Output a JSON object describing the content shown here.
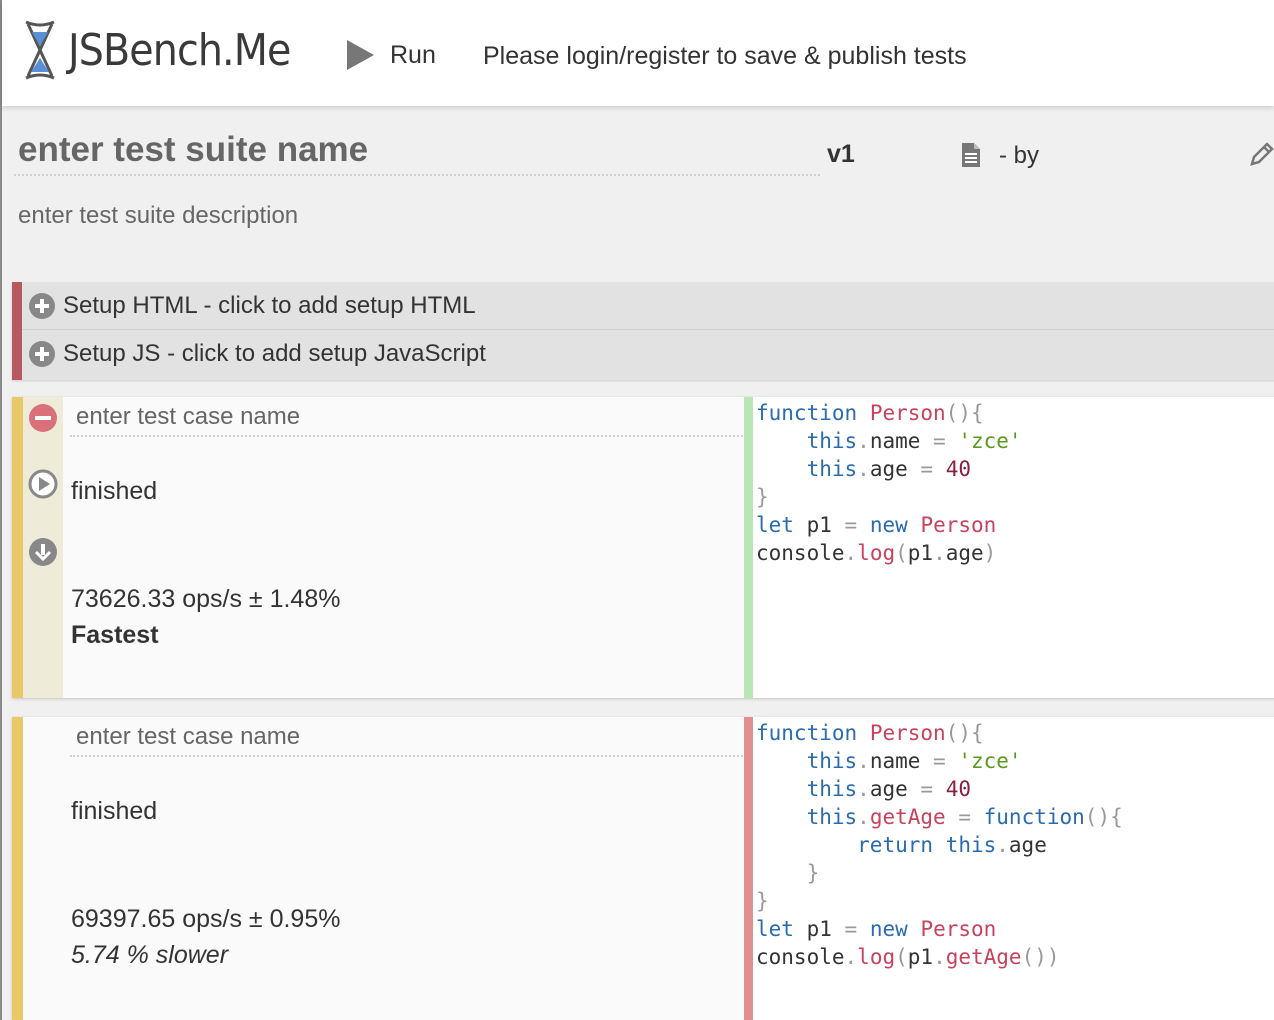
{
  "header": {
    "logo_text": "JSBench.Me",
    "run_label": "Run",
    "login_message": "Please login/register to save & publish tests"
  },
  "suite": {
    "name_placeholder": "enter test suite name",
    "version": "v1",
    "by_label": "- by",
    "description_placeholder": "enter test suite description"
  },
  "setup": {
    "html_label": "Setup HTML - click to add setup HTML",
    "js_label": "Setup JS - click to add setup JavaScript"
  },
  "cases": [
    {
      "name_placeholder": "enter test case name",
      "status": "finished",
      "ops": "73626.33 ops/s ± 1.48%",
      "verdict": "Fastest"
    },
    {
      "name_placeholder": "enter test case name",
      "status": "finished",
      "ops": "69397.65 ops/s ± 0.95%",
      "verdict": "5.74 % slower"
    }
  ],
  "code": {
    "function_kw": "function",
    "person": "Person",
    "this_kw": "this",
    "name_prop": "name",
    "age_prop": "age",
    "zce": "'zce'",
    "forty": "40",
    "let_kw": "let",
    "p1": "p1",
    "new_kw": "new",
    "console": "console",
    "log": "log",
    "getAge": "getAge",
    "return_kw": "return"
  },
  "colors": {
    "setup_stripe": "#b8595f",
    "case_stripe": "#e9c867",
    "fastest_border": "#b9e7b4",
    "slower_border": "#e0918f",
    "keyword": "#2a6bb0",
    "ident": "#c9425d",
    "string": "#5a9a22",
    "number": "#8a1f3f"
  },
  "icons": [
    "hourglass-logo-icon",
    "play-icon",
    "document-icon",
    "pencil-icon",
    "plus-circle-icon",
    "minus-circle-icon",
    "play-circle-icon",
    "download-circle-icon"
  ]
}
